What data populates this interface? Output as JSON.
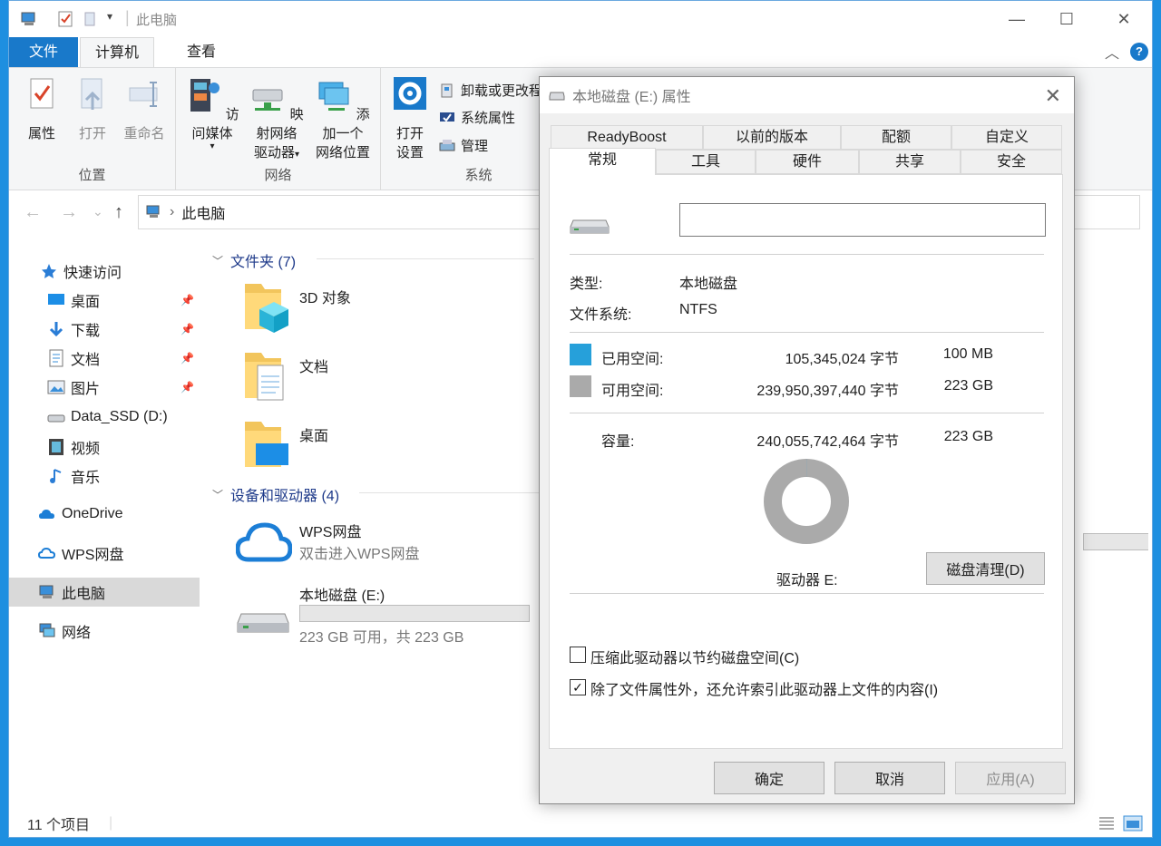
{
  "window": {
    "title": "此电脑",
    "qa_dropdown": "▾",
    "min": "—",
    "max": "☐",
    "close": "✕",
    "help": "?",
    "collapse": "︿"
  },
  "ribbon_tabs": {
    "file": "文件",
    "computer": "计算机",
    "view": "查看"
  },
  "ribbon": {
    "location": {
      "label": "位置",
      "properties": "属性",
      "open": "打开",
      "rename": "重命名"
    },
    "network": {
      "label": "网络",
      "access_media": "访问媒体",
      "map_drive_1": "映射网络",
      "map_drive_2": "驱动器",
      "add_location_1": "添加一个",
      "add_location_2": "网络位置"
    },
    "system": {
      "label": "系统",
      "open_settings_1": "打开",
      "open_settings_2": "设置",
      "uninstall": "卸载或更改程",
      "sys_props": "系统属性",
      "manage": "管理"
    }
  },
  "address": {
    "path": "此电脑",
    "sep": "›",
    "back": "←",
    "forward": "→",
    "recent": "⌄",
    "up": "↑"
  },
  "sidebar": {
    "quick_access": "快速访问",
    "desktop": "桌面",
    "downloads": "下载",
    "documents": "文档",
    "pictures": "图片",
    "data_ssd": "Data_SSD (D:)",
    "videos": "视频",
    "music": "音乐",
    "onedrive": "OneDrive",
    "wps": "WPS网盘",
    "this_pc": "此电脑",
    "network": "网络"
  },
  "content": {
    "folders_header": "文件夹 (7)",
    "folders": [
      "3D 对象",
      "文档",
      "桌面"
    ],
    "devices_header": "设备和驱动器 (4)",
    "wps_name": "WPS网盘",
    "wps_sub": "双击进入WPS网盘",
    "disk_name": "本地磁盘 (E:)",
    "disk_sub": "223 GB 可用，共 223 GB",
    "disk_fill": 0.0
  },
  "status": {
    "count": "11 个项目"
  },
  "dialog": {
    "title": "本地磁盘 (E:) 属性",
    "close": "✕",
    "tabs_top": [
      "ReadyBoost",
      "以前的版本",
      "配额",
      "自定义"
    ],
    "tabs_bottom": [
      "常规",
      "工具",
      "硬件",
      "共享",
      "安全"
    ],
    "name_value": "",
    "type_label": "类型:",
    "type_value": "本地磁盘",
    "fs_label": "文件系统:",
    "fs_value": "NTFS",
    "used_label": "已用空间:",
    "used_bytes": "105,345,024 字节",
    "used_size": "100 MB",
    "free_label": "可用空间:",
    "free_bytes": "239,950,397,440 字节",
    "free_size": "223 GB",
    "capacity_label": "容量:",
    "capacity_bytes": "240,055,742,464 字节",
    "capacity_size": "223 GB",
    "drive_label": "驱动器 E:",
    "cleanup_btn": "磁盘清理(D)",
    "compress_label": "压缩此驱动器以节约磁盘空间(C)",
    "compress_checked": false,
    "index_label": "除了文件属性外，还允许索引此驱动器上文件的内容(I)",
    "index_checked": true,
    "check_mark": "✓",
    "ok": "确定",
    "cancel": "取消",
    "apply": "应用(A)",
    "used_fraction": 0.0004
  },
  "colors": {
    "used": "#26a0da",
    "free": "#aaaaaa",
    "accent": "#1979ca"
  }
}
